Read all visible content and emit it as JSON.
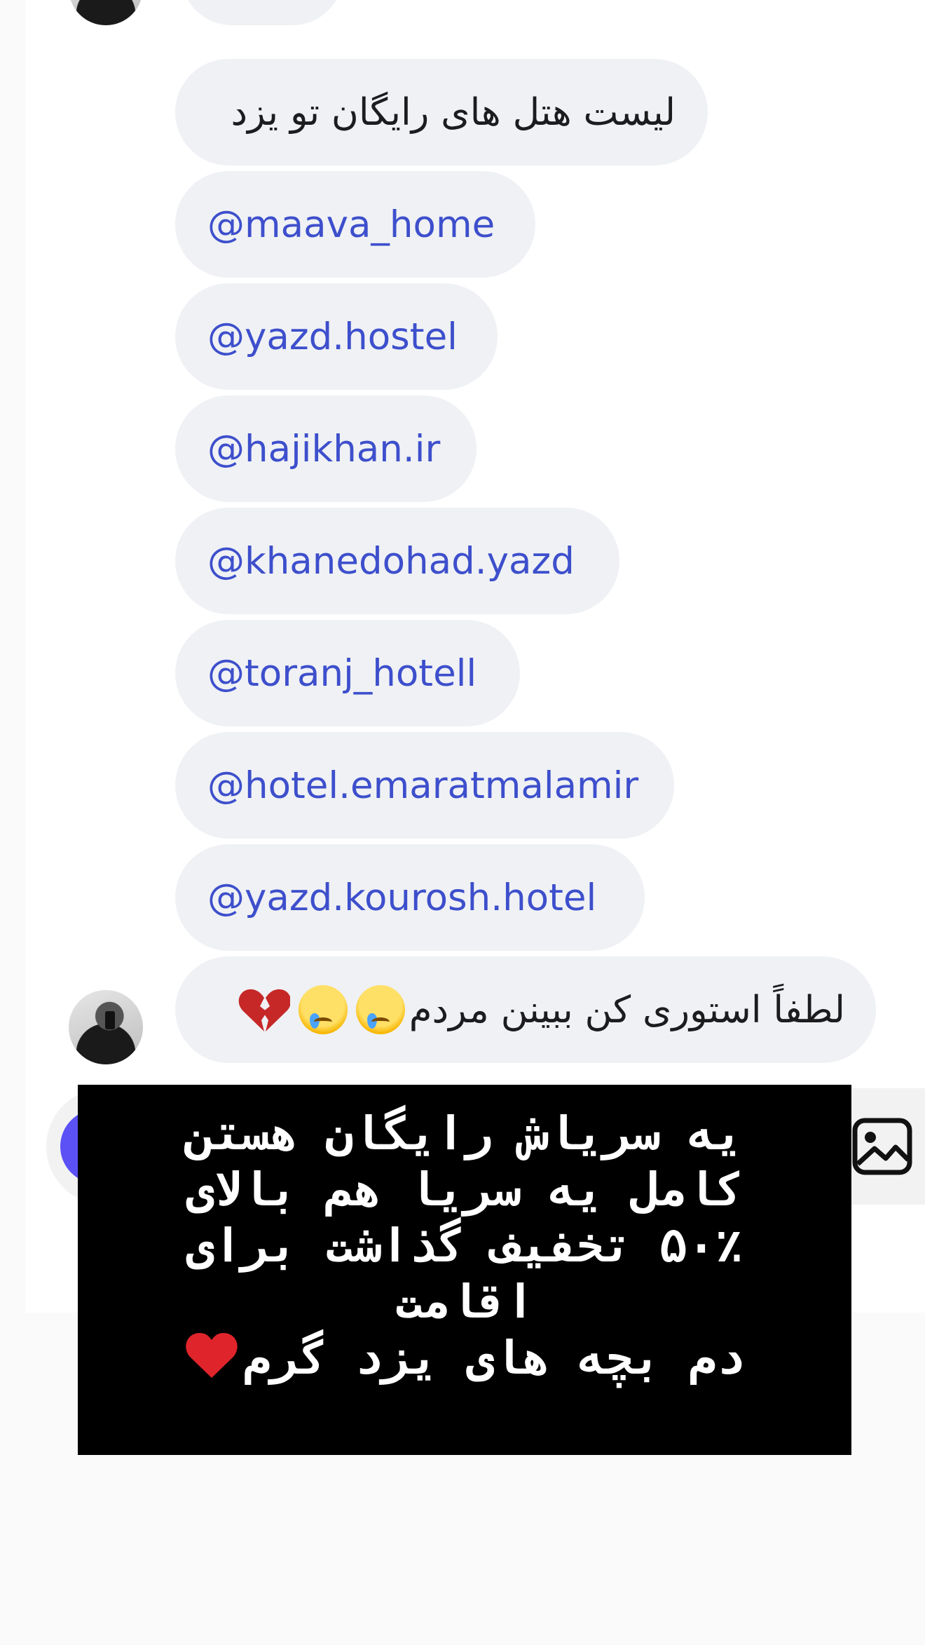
{
  "messages": [
    {
      "text": "لیست هتل های رایگان تو یزد",
      "type": "text"
    },
    {
      "text": "@maava_home",
      "type": "mention"
    },
    {
      "text": "@yazd.hostel",
      "type": "mention"
    },
    {
      "text": "@hajikhan.ir",
      "type": "mention"
    },
    {
      "text": "@khanedohad.yazd",
      "type": "mention"
    },
    {
      "text": "@toranj_hotell",
      "type": "mention"
    },
    {
      "text": "@hotel.emaratmalamir",
      "type": "mention"
    },
    {
      "text": "@yazd.kourosh.hotel",
      "type": "mention"
    },
    {
      "text": "لطفاً استوری کن ببینن مردم",
      "type": "text",
      "emojis": [
        "crying-face",
        "crying-face",
        "broken-heart"
      ]
    }
  ],
  "story_overlay": {
    "lines": [
      "یه سریاش رایگان هستن",
      "کامل یه سریا هم بالای",
      "۵۰٪ تخفیف گذاشت برای",
      "اقامت",
      "دم بچه های یزد گرم"
    ],
    "end_emoji": "red-heart"
  },
  "colors": {
    "bubble_bg": "#eff1f4",
    "mention": "#3d4fcc",
    "camera_button": "#5b51f5",
    "overlay_bg": "#000000"
  },
  "icons": {
    "composer_left": "camera-icon",
    "composer_right": "gallery-icon"
  }
}
